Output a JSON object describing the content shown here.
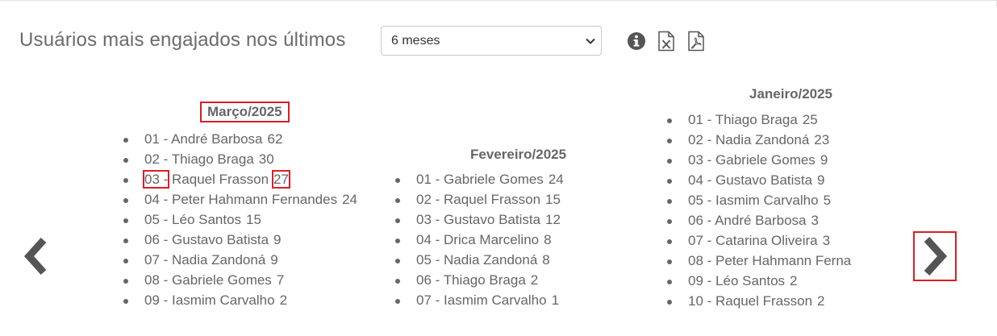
{
  "header": {
    "title": "Usuários mais engajados nos últimos",
    "period_select": {
      "value": "6 meses"
    },
    "icons": [
      "info-icon",
      "excel-export-icon",
      "pdf-export-icon"
    ]
  },
  "months": [
    {
      "title": "Março/2025",
      "items": [
        {
          "rank": "01 -",
          "name": "André Barbosa",
          "count": "62"
        },
        {
          "rank": "02 -",
          "name": "Thiago Braga",
          "count": "30"
        },
        {
          "rank": "03 -",
          "name": "Raquel Frasson",
          "count": "27"
        },
        {
          "rank": "04 -",
          "name": "Peter Hahmann Fernandes",
          "count": "24"
        },
        {
          "rank": "05 -",
          "name": "Léo Santos",
          "count": "15"
        },
        {
          "rank": "06 -",
          "name": "Gustavo Batista",
          "count": "9"
        },
        {
          "rank": "07 -",
          "name": "Nadia Zandoná",
          "count": "9"
        },
        {
          "rank": "08 -",
          "name": "Gabriele Gomes",
          "count": "7"
        },
        {
          "rank": "09 -",
          "name": "Iasmim Carvalho",
          "count": "2"
        }
      ]
    },
    {
      "title": "Fevereiro/2025",
      "items": [
        {
          "rank": "01 -",
          "name": "Gabriele Gomes",
          "count": "24"
        },
        {
          "rank": "02 -",
          "name": "Raquel Frasson",
          "count": "15"
        },
        {
          "rank": "03 -",
          "name": "Gustavo Batista",
          "count": "12"
        },
        {
          "rank": "04 -",
          "name": "Drica Marcelino",
          "count": "8"
        },
        {
          "rank": "05 -",
          "name": "Nadia Zandoná",
          "count": "8"
        },
        {
          "rank": "06 -",
          "name": "Thiago Braga",
          "count": "2"
        },
        {
          "rank": "07 -",
          "name": "Iasmim Carvalho",
          "count": "1"
        }
      ]
    },
    {
      "title": "Janeiro/2025",
      "items": [
        {
          "rank": "01 -",
          "name": "Thiago Braga",
          "count": "25"
        },
        {
          "rank": "02 -",
          "name": "Nadia Zandoná",
          "count": "23"
        },
        {
          "rank": "03 -",
          "name": "Gabriele Gomes",
          "count": "9"
        },
        {
          "rank": "04 -",
          "name": "Gustavo Batista",
          "count": "9"
        },
        {
          "rank": "05 -",
          "name": "Iasmim Carvalho",
          "count": "5"
        },
        {
          "rank": "06 -",
          "name": "André Barbosa",
          "count": "3"
        },
        {
          "rank": "07 -",
          "name": "Catarina Oliveira",
          "count": "3"
        },
        {
          "rank": "08 -",
          "name": "Peter Hahmann Ferna",
          "count": ""
        },
        {
          "rank": "09 -",
          "name": "Léo Santos",
          "count": "2"
        },
        {
          "rank": "10 -",
          "name": "Raquel Frasson",
          "count": "2"
        }
      ]
    }
  ],
  "carousel": {
    "prev_icon": "chevron-left-icon",
    "next_icon": "chevron-right-icon"
  },
  "colors": {
    "text": "#666666",
    "highlight": "#d91f26",
    "arrow": "#555555"
  }
}
